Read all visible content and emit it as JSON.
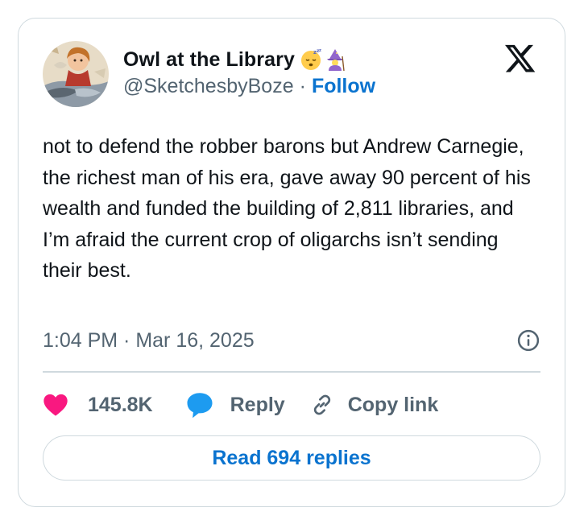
{
  "author": {
    "display_name": "Owl at the Library",
    "name_emojis": [
      "sleeping-face-icon",
      "mage-icon"
    ],
    "handle": "@SketchesbyBoze",
    "separator": "·",
    "follow_label": "Follow"
  },
  "brand_icon": "x-logo-icon",
  "tweet": {
    "text": "not to defend the robber barons but Andrew Carnegie, the richest man of his era, gave away 90 percent of his wealth and funded the building of 2,811 libraries, and I’m afraid the current crop of oligarchs isn’t sending their best.",
    "timestamp": "1:04 PM · Mar 16, 2025"
  },
  "actions": {
    "like_count": "145.8K",
    "reply_label": "Reply",
    "copy_link_label": "Copy link"
  },
  "read_replies_label": "Read 694 replies",
  "colors": {
    "link_blue": "#0a73cf",
    "like_pink": "#f91880",
    "reply_blue": "#1d9bf0",
    "muted_text": "#536471",
    "border": "#cfd9de"
  }
}
